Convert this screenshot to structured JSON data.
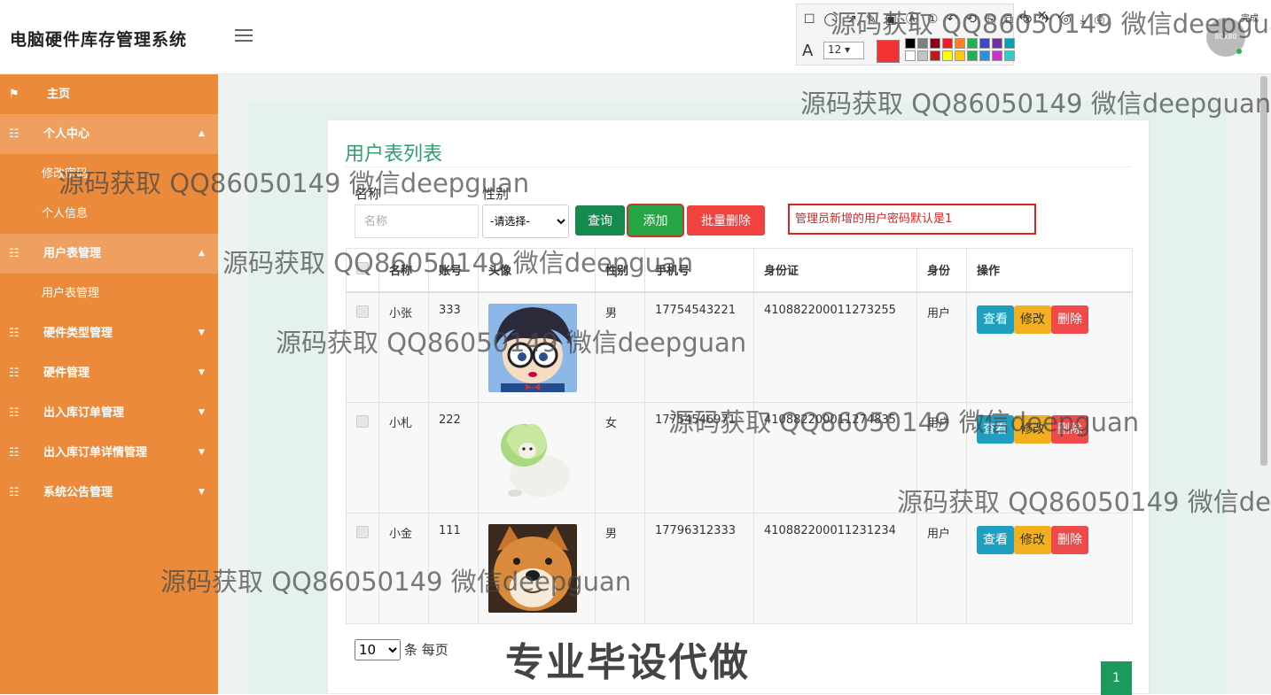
{
  "header": {
    "title": "电脑硬件库存管理系统",
    "avatar_text": "80x80"
  },
  "annotation_toolbar": {
    "tools": "☐◯↗✎▣Ⓐ①↶⟲⎘⧉⊗✈◎⤓⎙",
    "tools_extra": "↲✕✓",
    "done_label": "完成",
    "font_size": "12",
    "current_color": "#f33333",
    "palette": [
      "#000000",
      "#7f7f7f",
      "#880015",
      "#ed1c24",
      "#ff7f27",
      "#22b14c",
      "#3f48cc",
      "#7030a0",
      "#00a2b3",
      "#ffffff",
      "#c3c3c3",
      "#b91c1c",
      "#ffff00",
      "#ffc90e",
      "#22b14c",
      "#2f8fdf",
      "#cc33cc",
      "#33cccc"
    ]
  },
  "sidebar": {
    "items": [
      {
        "icon": "flag-icon",
        "label": "主页"
      },
      {
        "icon": "grid-icon",
        "label": "个人中心",
        "expanded": true,
        "children": [
          "修改密码",
          "个人信息"
        ]
      },
      {
        "icon": "grid-icon",
        "label": "用户表管理",
        "expanded": true,
        "children": [
          "用户表管理"
        ]
      },
      {
        "icon": "grid-icon",
        "label": "硬件类型管理"
      },
      {
        "icon": "grid-icon",
        "label": "硬件管理"
      },
      {
        "icon": "grid-icon",
        "label": "出入库订单管理"
      },
      {
        "icon": "grid-icon",
        "label": "出入库订单详情管理"
      },
      {
        "icon": "grid-icon",
        "label": "系统公告管理"
      }
    ]
  },
  "page": {
    "title": "用户表列表",
    "filter": {
      "name_label": "名称",
      "name_placeholder": "名称",
      "sex_label": "性别",
      "sex_selected": "-请选择-"
    },
    "buttons": {
      "query": "查询",
      "add": "添加",
      "batch_delete": "批量删除"
    },
    "notice": "管理员新增的用户密码默认是1"
  },
  "table": {
    "columns": [
      "",
      "名称",
      "账号",
      "头像",
      "性别",
      "手机号",
      "身份证",
      "身份",
      "操作"
    ],
    "rows": [
      {
        "name": "小张",
        "account": "333",
        "avatar": "conan-avatar",
        "sex": "男",
        "phone": "17754543221",
        "id_card": "410882200011273255",
        "role": "用户"
      },
      {
        "name": "小札",
        "account": "222",
        "avatar": "cabbage-dog-avatar",
        "sex": "女",
        "phone": "17754546971",
        "id_card": "410882200011274835",
        "role": "用户"
      },
      {
        "name": "小金",
        "account": "111",
        "avatar": "shiba-avatar",
        "sex": "男",
        "phone": "17796312333",
        "id_card": "410882200011231234",
        "role": "用户"
      }
    ],
    "actions": {
      "view": "查看",
      "edit": "修改",
      "delete": "删除"
    }
  },
  "pagination": {
    "page_size": "10",
    "page_size_suffix": "条 每页",
    "current_page": "1"
  },
  "watermarks": {
    "text": "源码获取 QQ86050149 微信deepguan",
    "big_text": "专业毕设代做"
  }
}
